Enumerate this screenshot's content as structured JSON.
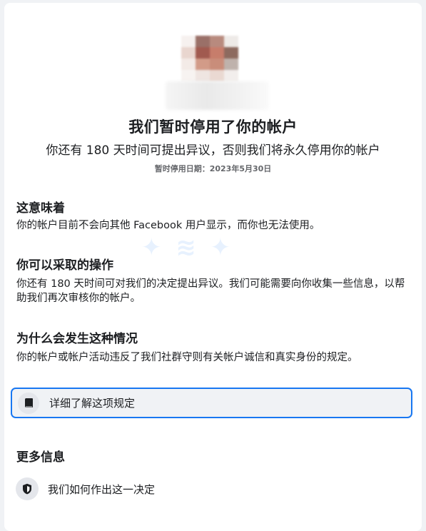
{
  "header": {
    "title": "我们暂时停用了你的帐户",
    "subtitle": "你还有 180 天时间可提出异议，否则我们将永久停用你的帐户",
    "date_line": "暂时停用日期：2023年5月30日"
  },
  "sections": {
    "meaning": {
      "heading": "这意味着",
      "body": "你的帐户目前不会向其他 Facebook 用户显示，而你也无法使用。"
    },
    "actions": {
      "heading": "你可以采取的操作",
      "body": "你还有 180 天时间可对我们的决定提出异议。我们可能需要向你收集一些信息，以帮助我们再次审核你的帐户。"
    },
    "why": {
      "heading": "为什么会发生这种情况",
      "body": "你的帐户或帐户活动违反了我们社群守则有关帐户诚信和真实身份的规定。"
    },
    "more": {
      "heading": "更多信息"
    }
  },
  "buttons": {
    "learn_rule": {
      "label": "详细了解这项规定",
      "icon": "book-icon"
    },
    "how_decided": {
      "label": "我们如何作出这一决定",
      "icon": "shield-icon"
    }
  },
  "colors": {
    "accent": "#1877f2",
    "background": "#f0f2f5",
    "card": "#ffffff",
    "text": "#1c1e21",
    "secondary_text": "#65676b"
  }
}
